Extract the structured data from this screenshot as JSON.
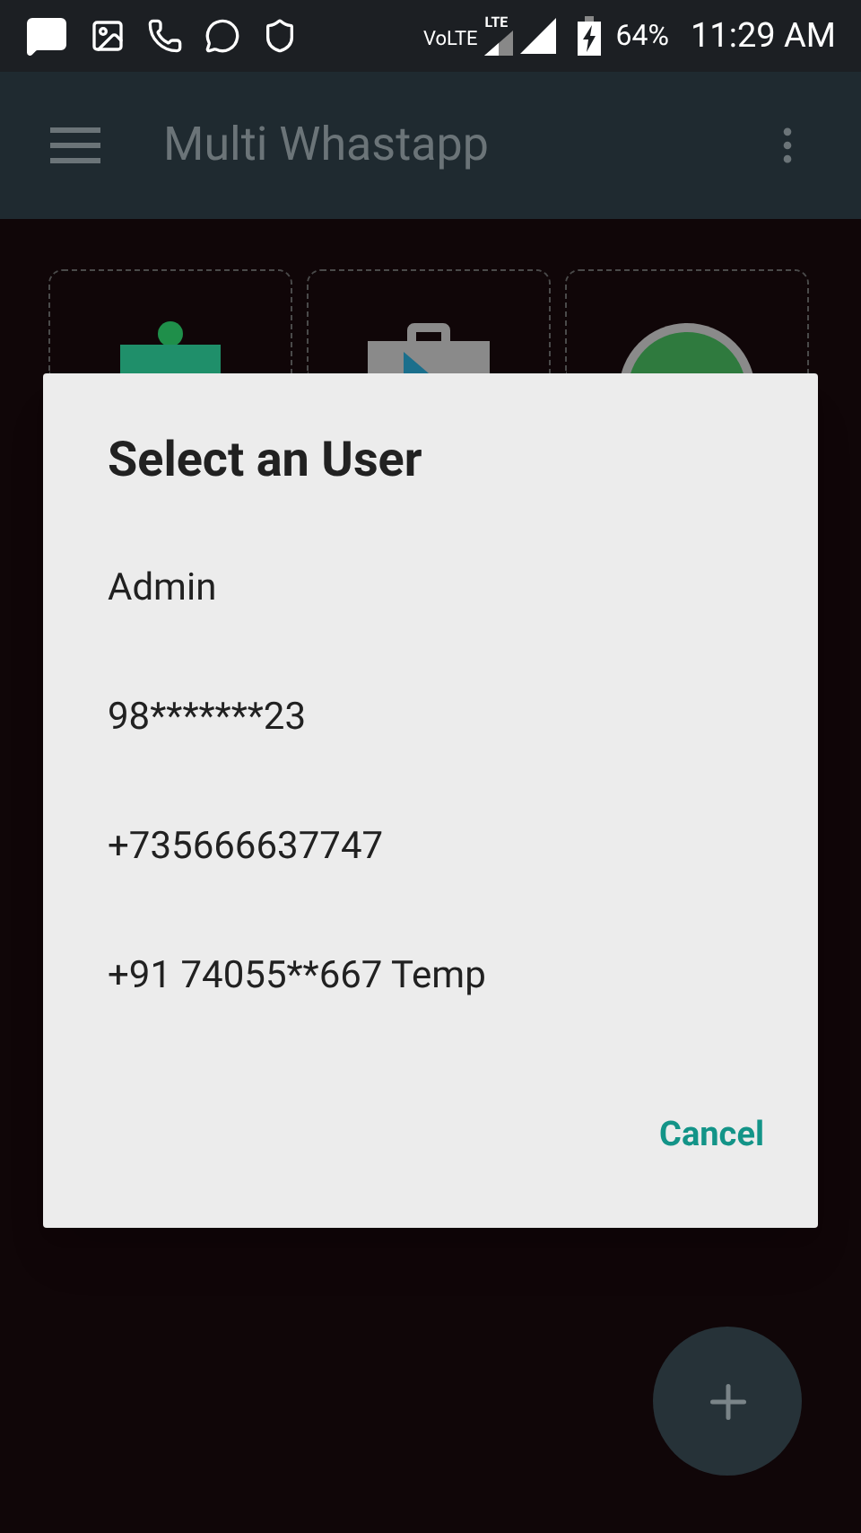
{
  "status_bar": {
    "volte": "VoLTE",
    "network": "LTE",
    "battery": "64%",
    "time": "11:29 AM"
  },
  "app_bar": {
    "title": "Multi Whastapp"
  },
  "tiles": [
    {
      "kind": "puzzle"
    },
    {
      "kind": "store"
    },
    {
      "kind": "chat"
    }
  ],
  "dialog": {
    "title": "Select an User",
    "options": [
      {
        "label": "Admin"
      },
      {
        "label": "98*******23"
      },
      {
        "label": "+735666637747"
      },
      {
        "label": "+91 74055**667 Temp"
      }
    ],
    "button": "Cancel"
  }
}
